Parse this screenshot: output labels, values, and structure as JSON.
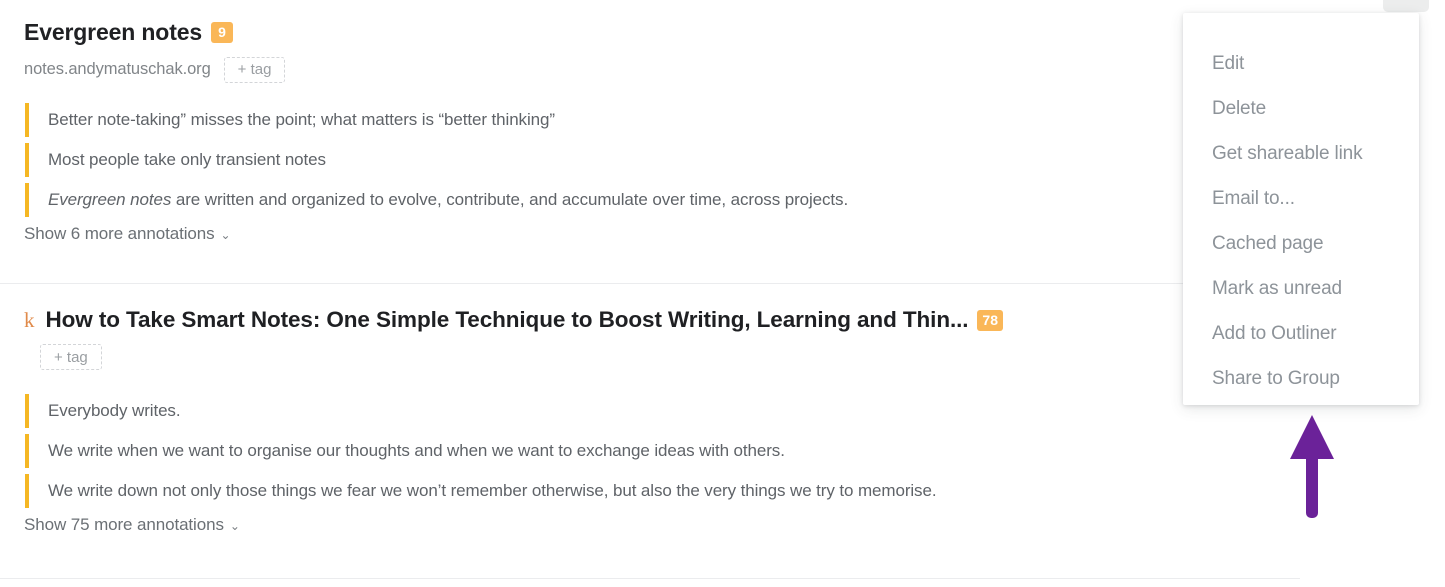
{
  "theme": {
    "highlight_bar": "#f5b724",
    "badge_bg": "#fab758",
    "badge_text": "#ffffff",
    "annotation_text": "#5f6368",
    "menu_text": "#8d9399",
    "arrow": "#6b2299",
    "divider": "#ebecee",
    "kindle_icon": "#e08a4a"
  },
  "articles": [
    {
      "title": "Evergreen notes",
      "badge": "9",
      "domain": "notes.andymatuschak.org",
      "tag_label": "+ tag",
      "source_icon": null,
      "annotations": [
        "Better note-taking” misses the point; what matters is “better thinking”",
        "Most people take only transient notes",
        "Evergreen notes are written and organized to evolve, contribute, and accumulate over time, across projects."
      ],
      "annotation_italic_prefix": [
        "",
        "",
        "Evergreen notes"
      ],
      "show_more": "Show 6 more annotations"
    },
    {
      "title": "How to Take Smart Notes: One Simple Technique to Boost Writing, Learning and Thin...",
      "badge": "78",
      "domain": "",
      "tag_label": "+ tag",
      "source_icon": "k",
      "annotations": [
        "Everybody writes.",
        "We write when we want to organise our thoughts and when we want to exchange ideas with others.",
        "We write down not only those things we fear we won’t remember otherwise, but also the very things we try to memorise."
      ],
      "annotation_italic_prefix": [
        "",
        "",
        ""
      ],
      "show_more": "Show 75 more annotations"
    }
  ],
  "context_menu": {
    "items": [
      "Edit",
      "Delete",
      "Get shareable link",
      "Email to...",
      "Cached page",
      "Mark as unread",
      "Add to Outliner",
      "Share to Group"
    ]
  },
  "chevron_glyph": "⌄"
}
